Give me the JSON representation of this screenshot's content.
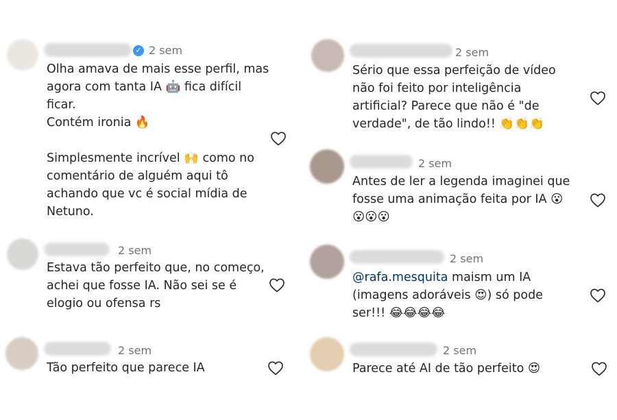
{
  "left_comments": [
    {
      "time": "2 sem",
      "verified": true,
      "text": "Olha amava de mais esse perfil, mas\nagora com tanta IA 🤖 fica difícil\nficar.\nContém ironia 🔥\n\nSimplesmente incrível 🙌 como no\ncomentário de alguém aqui tô\nachando que vc é social mídia de\nNetuno."
    },
    {
      "time": "2 sem",
      "verified": false,
      "text": "Estava tão perfeito que, no começo,\nachei que fosse IA. Não sei se é\nelogio ou ofensa rs"
    },
    {
      "time": "2 sem",
      "verified": false,
      "text": "Tão perfeito que parece IA"
    }
  ],
  "right_comments": [
    {
      "time": "2 sem",
      "text": "Sério que essa perfeição de vídeo\nnão foi feito por inteligência\nartificial? Parece que não é \"de\nverdade\", de tão lindo!! 👏👏👏"
    },
    {
      "time": "2 sem",
      "text": "Antes de ler a legenda imaginei que\nfosse uma animação feita por IA 😮\n😮😮😮"
    },
    {
      "time": "2 sem",
      "mention": "@rafa.mesquita",
      "text": " maism um IA\n(imagens adoráveis 😍) só pode\nser!!! 😂😂😂😂"
    },
    {
      "time": "2 sem",
      "text": "Parece até AI de tão perfeito 😍"
    }
  ],
  "colors": {
    "text": "#262626",
    "time": "#737373",
    "mention": "#00376b",
    "verified": "#3897f0"
  },
  "icons": {
    "like": "heart-outline-icon",
    "verified": "verified-badge-icon"
  }
}
